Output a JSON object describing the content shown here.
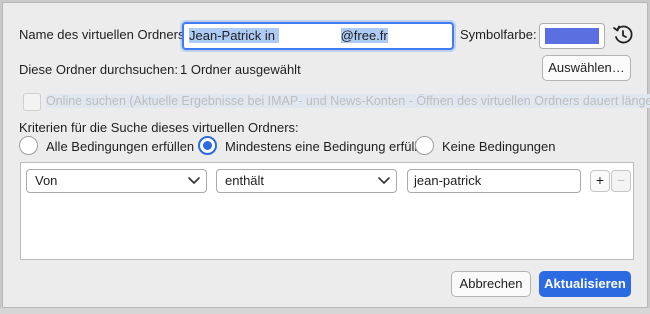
{
  "form": {
    "name_label": "Name des virtuellen Ordners:",
    "name_value_start": "Jean-Patrick in ",
    "name_value_end": "@free.fr",
    "color_label": "Symbolfarbe:",
    "color_value": "#5b6fe0",
    "search_label": "Diese Ordner durchsuchen:",
    "search_value": "1 Ordner ausgewählt",
    "select_button": "Auswählen…",
    "online_search_label": "Online suchen (Aktuelle Ergebnisse bei IMAP- und News-Konten - Öffnen des virtuellen Ordners dauert länger)"
  },
  "criteria": {
    "heading": "Kriterien für die Suche dieses virtuellen Ordners:",
    "options": [
      "Alle Bedingungen erfüllen",
      "Mindestens eine Bedingung erfüllen",
      "Keine Bedingungen"
    ],
    "selected": "Mindestens eine Bedingung erfüllen",
    "rule": {
      "field": "Von",
      "operator": "enthält",
      "value": "jean-patrick",
      "add": "+",
      "remove": "−"
    }
  },
  "buttons": {
    "cancel": "Abbrechen",
    "update": "Aktualisieren"
  },
  "icons": [
    "history-reset-icon",
    "chevron-down-icon"
  ]
}
